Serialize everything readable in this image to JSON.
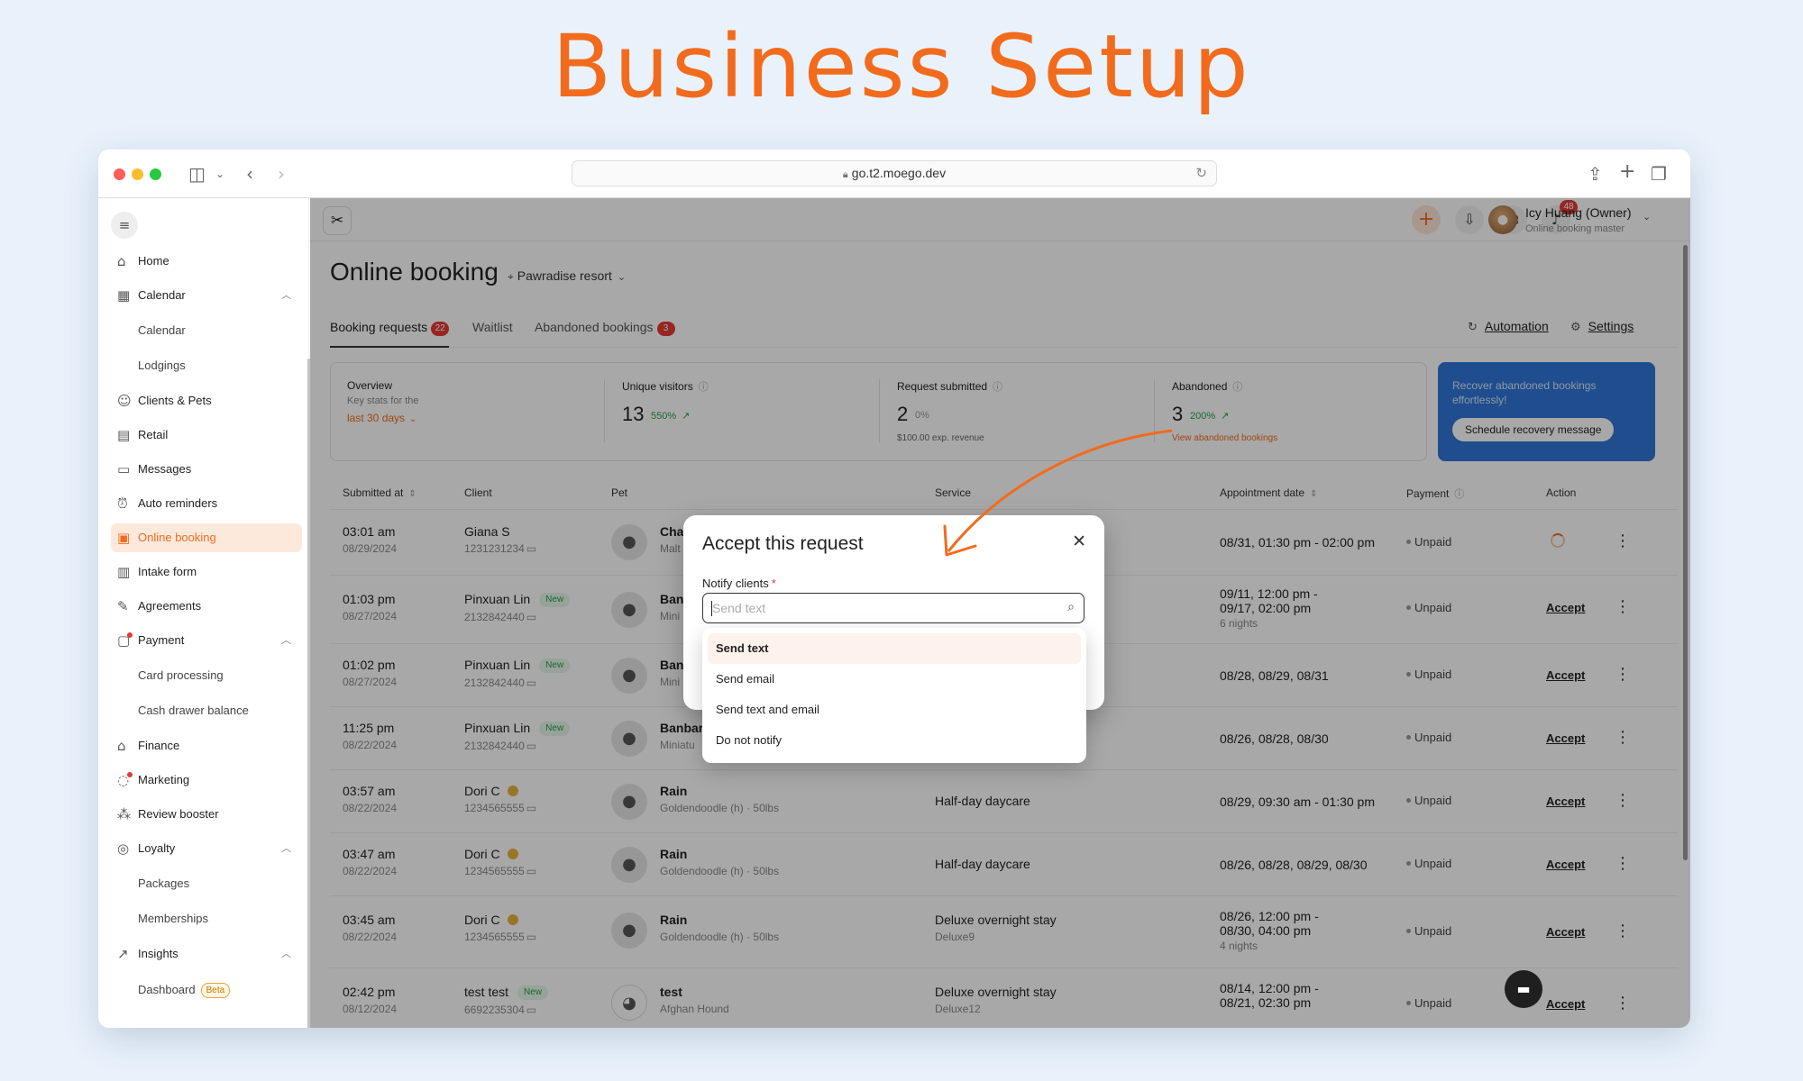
{
  "hero_title": "Business Setup",
  "browser": {
    "url": "go.t2.moego.dev"
  },
  "sidebar": {
    "items": [
      {
        "label": "Home"
      },
      {
        "label": "Calendar"
      },
      {
        "label": "Calendar"
      },
      {
        "label": "Lodgings"
      },
      {
        "label": "Clients & Pets"
      },
      {
        "label": "Retail"
      },
      {
        "label": "Messages"
      },
      {
        "label": "Auto reminders"
      },
      {
        "label": "Online booking"
      },
      {
        "label": "Intake form"
      },
      {
        "label": "Agreements"
      },
      {
        "label": "Payment"
      },
      {
        "label": "Card processing"
      },
      {
        "label": "Cash drawer balance"
      },
      {
        "label": "Finance"
      },
      {
        "label": "Marketing"
      },
      {
        "label": "Review booster"
      },
      {
        "label": "Loyalty"
      },
      {
        "label": "Packages"
      },
      {
        "label": "Memberships"
      },
      {
        "label": "Insights"
      },
      {
        "label": "Dashboard"
      }
    ],
    "beta_badge": "Beta"
  },
  "topbar": {
    "notification_count": "48",
    "user_name": "Icy Huang (Owner)",
    "user_role": "Online booking master"
  },
  "page": {
    "title": "Online booking",
    "location": "Pawradise resort"
  },
  "tabs": [
    {
      "label": "Booking requests",
      "count": "22"
    },
    {
      "label": "Waitlist"
    },
    {
      "label": "Abandoned bookings",
      "count": "3"
    }
  ],
  "links": {
    "automation": "Automation",
    "settings": "Settings"
  },
  "stats": {
    "overview": {
      "label": "Overview",
      "sub": "Key stats for the",
      "period": "last 30 days"
    },
    "unique_visitors": {
      "label": "Unique visitors",
      "value": "13",
      "change": "550%"
    },
    "request_submitted": {
      "label": "Request submitted",
      "value": "2",
      "change": "0%",
      "extra": "$100.00 exp. revenue"
    },
    "abandoned": {
      "label": "Abandoned",
      "value": "3",
      "change": "200%",
      "extra": "View abandoned bookings"
    }
  },
  "recover": {
    "text": "Recover abandoned bookings effortlessly!",
    "button": "Schedule recovery message"
  },
  "table": {
    "headers": {
      "submitted": "Submitted at",
      "client": "Client",
      "pet": "Pet",
      "service": "Service",
      "appointment": "Appointment date",
      "payment": "Payment",
      "action": "Action"
    },
    "rows": [
      {
        "time": "03:01 am",
        "date": "08/29/2024",
        "client": "Giana S",
        "phone": "1231231234",
        "pet": "Cha",
        "breed": "Malt",
        "service": "",
        "service_sub": "",
        "appt": "08/31, 01:30 pm - 02:00 pm",
        "appt2": "",
        "appt3": "",
        "payment": "Unpaid",
        "action": ""
      },
      {
        "time": "01:03 pm",
        "date": "08/27/2024",
        "client": "Pinxuan Lin",
        "new": "New",
        "phone": "2132842440",
        "pet": "Ban",
        "breed": "Mini",
        "service": "",
        "service_sub": "",
        "appt": "09/11, 12:00 pm -",
        "appt2": "09/17, 02:00 pm",
        "appt3": "6 nights",
        "payment": "Unpaid",
        "action": "Accept"
      },
      {
        "time": "01:02 pm",
        "date": "08/27/2024",
        "client": "Pinxuan Lin",
        "new": "New",
        "phone": "2132842440",
        "pet": "Ban",
        "breed": "Mini",
        "service": "",
        "service_sub": "",
        "appt": "08/28, 08/29, 08/31",
        "appt2": "",
        "appt3": "",
        "payment": "Unpaid",
        "action": "Accept"
      },
      {
        "time": "11:25 pm",
        "date": "08/22/2024",
        "client": "Pinxuan Lin",
        "new": "New",
        "phone": "2132842440",
        "pet": "Banbar",
        "breed": "Miniatu",
        "service": "",
        "service_sub": "",
        "appt": "08/26, 08/28, 08/30",
        "appt2": "",
        "appt3": "",
        "payment": "Unpaid",
        "action": "Accept"
      },
      {
        "time": "03:57 am",
        "date": "08/22/2024",
        "client": "Dori C",
        "phone": "1234565555",
        "pet": "Rain",
        "breed": "Goldendoodle (h) · 50lbs",
        "service": "Half-day daycare",
        "service_sub": "",
        "appt": "08/29, 09:30 am - 01:30 pm",
        "appt2": "",
        "appt3": "",
        "payment": "Unpaid",
        "action": "Accept"
      },
      {
        "time": "03:47 am",
        "date": "08/22/2024",
        "client": "Dori C",
        "phone": "1234565555",
        "pet": "Rain",
        "breed": "Goldendoodle (h) · 50lbs",
        "service": "Half-day daycare",
        "service_sub": "",
        "appt": "08/26, 08/28, 08/29, 08/30",
        "appt2": "",
        "appt3": "",
        "payment": "Unpaid",
        "action": "Accept"
      },
      {
        "time": "03:45 am",
        "date": "08/22/2024",
        "client": "Dori C",
        "phone": "1234565555",
        "pet": "Rain",
        "breed": "Goldendoodle (h) · 50lbs",
        "service": "Deluxe overnight stay",
        "service_sub": "Deluxe9",
        "appt": "08/26, 12:00 pm -",
        "appt2": "08/30, 04:00 pm",
        "appt3": "4 nights",
        "payment": "Unpaid",
        "action": "Accept"
      },
      {
        "time": "02:42 pm",
        "date": "08/12/2024",
        "client": "test test",
        "new": "New",
        "phone": "6692235304",
        "pet": "test",
        "breed": "Afghan Hound",
        "service": "Deluxe overnight stay",
        "service_sub": "Deluxe12",
        "appt": "08/14, 12:00 pm -",
        "appt2": "08/21, 02:30 pm",
        "appt3": "",
        "payment": "Unpaid",
        "action": "Accept"
      }
    ]
  },
  "modal": {
    "title": "Accept this request",
    "field_label": "Notify clients",
    "placeholder": "Send text",
    "options": [
      "Send text",
      "Send email",
      "Send text and email",
      "Do not notify"
    ]
  },
  "colors": {
    "accent": "#f26b1d",
    "recover_bg": "#2f75d8",
    "badge_red": "#e53935"
  }
}
